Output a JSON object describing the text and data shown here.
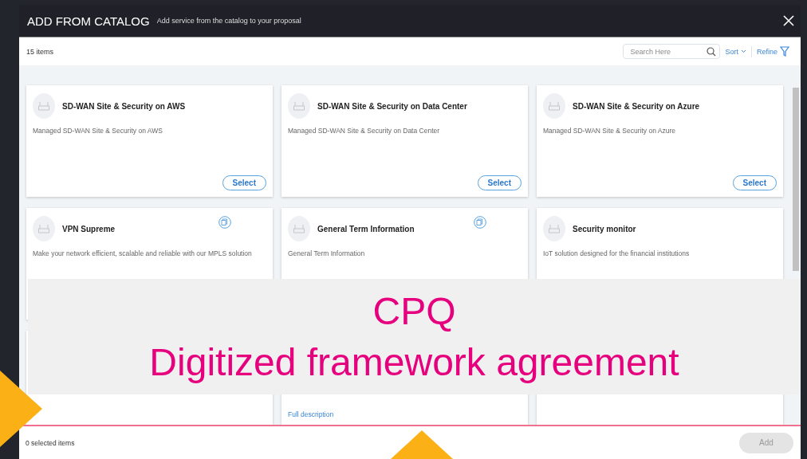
{
  "dialog": {
    "title": "ADD FROM CATALOG",
    "subtitle": "Add service from the catalog to your proposal"
  },
  "toolbar": {
    "item_count": "15 items",
    "search": {
      "placeholder": "Search Here"
    },
    "sort": "Sort",
    "refine": "Refine"
  },
  "cards": [
    {
      "kind": "full",
      "title": "SD-WAN Site & Security on AWS",
      "description": "Managed SD-WAN Site & Security on AWS",
      "copy_icon": false,
      "button": "Select"
    },
    {
      "kind": "full",
      "title": "SD-WAN Site & Security on Data Center",
      "description": "Managed SD-WAN Site & Security on Data Center",
      "copy_icon": false,
      "button": "Select"
    },
    {
      "kind": "full",
      "title": "SD-WAN Site & Security on Azure",
      "description": "Managed SD-WAN Site & Security on Azure",
      "copy_icon": false,
      "button": "Select"
    },
    {
      "kind": "full",
      "title": "VPN Supreme",
      "description": "Make your network efficient, scalable and reliable with our MPLS solution",
      "copy_icon": true
    },
    {
      "kind": "full",
      "title": "General Term Information",
      "description": "General Term Information",
      "copy_icon": true
    },
    {
      "kind": "full",
      "title": "Security monitor",
      "description": "IoT solution designed for the financial institutions",
      "copy_icon": false
    },
    {
      "kind": "partial"
    },
    {
      "kind": "partial",
      "link": "Full description"
    },
    {
      "kind": "partial"
    }
  ],
  "footer": {
    "selected_count": "0 selected items",
    "add_button": {
      "label": "Add",
      "disabled": true
    }
  },
  "banner": {
    "lines": [
      "CPQ",
      "Digitized framework agreement"
    ]
  }
}
